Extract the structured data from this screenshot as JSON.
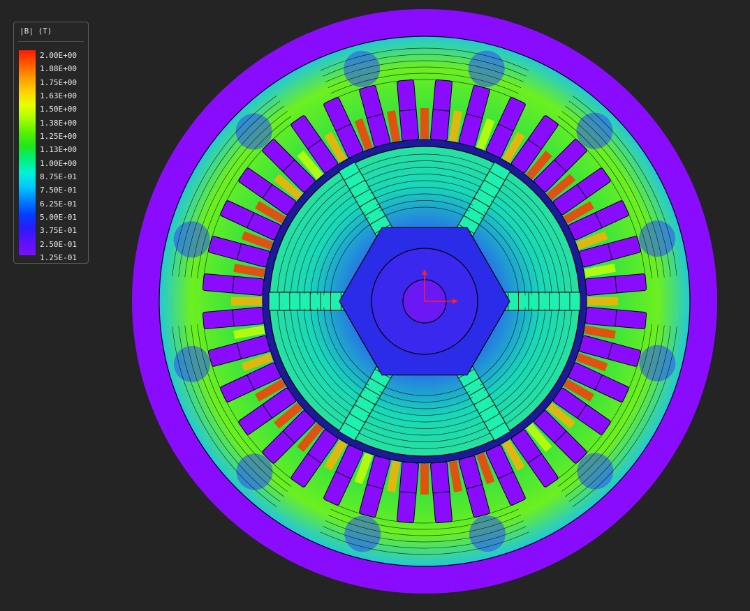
{
  "legend": {
    "title": "|B| (T)",
    "ticks": [
      "2.00E+00",
      "1.88E+00",
      "1.75E+00",
      "1.63E+00",
      "1.50E+00",
      "1.38E+00",
      "1.25E+00",
      "1.13E+00",
      "1.00E+00",
      "8.75E-01",
      "7.50E-01",
      "6.25E-01",
      "5.00E-01",
      "3.75E-01",
      "2.50E-01",
      "1.25E-01"
    ],
    "colors": [
      "#ff1a00",
      "#ff5a00",
      "#ff9a00",
      "#ffd000",
      "#e8ff00",
      "#a8ff00",
      "#5cf000",
      "#1ee81a",
      "#00f080",
      "#00f2d8",
      "#00c8ff",
      "#0080ff",
      "#0040ff",
      "#2a1aff",
      "#5a10ff",
      "#7a10ff"
    ]
  },
  "colors": {
    "background": "#242424",
    "outer_ring": "#8a0cff",
    "stator_yoke": "#3cdc3c",
    "rotor_core": "#2a2ce8",
    "slot_fill": "#8a0cff",
    "magnet_fill": "#1ef0b0",
    "outline": "#000000",
    "axis_x": "#ff2020",
    "axis_y": "#ff2020"
  },
  "geometry_model": {
    "stator_slots": 36,
    "rotor_poles": 6,
    "hub_shape": "hexagon"
  }
}
